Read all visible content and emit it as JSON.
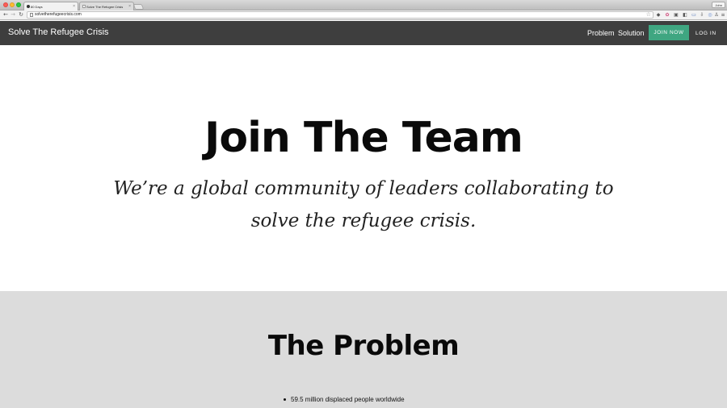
{
  "browser": {
    "profile_name": "John",
    "tabs": [
      {
        "label": "80 Days",
        "active": true
      },
      {
        "label": "Solve The Refugee Crisis",
        "active": false
      }
    ],
    "url": "solvetherefugeecrisis.com",
    "extension_icons": [
      "shield-icon",
      "color-wheel-icon",
      "box-icon",
      "puzzle-icon",
      "monitor-icon",
      "download-icon",
      "globe-icon",
      "person-icon",
      "menu-icon"
    ]
  },
  "nav": {
    "brand": "Solve The Refugee Crisis",
    "links": [
      "Problem",
      "Solution"
    ],
    "join_label": "JOIN NOW",
    "login_label": "LOG IN",
    "join_color": "#3fa681",
    "bar_color": "#3e3e3e"
  },
  "hero": {
    "title": "Join The Team",
    "subtitle": "We’re a global community of leaders collaborating to solve the refugee crisis."
  },
  "problem": {
    "title": "The Problem",
    "bullets": [
      "59.5 million displaced people worldwide"
    ],
    "background": "#dcdcdc"
  }
}
